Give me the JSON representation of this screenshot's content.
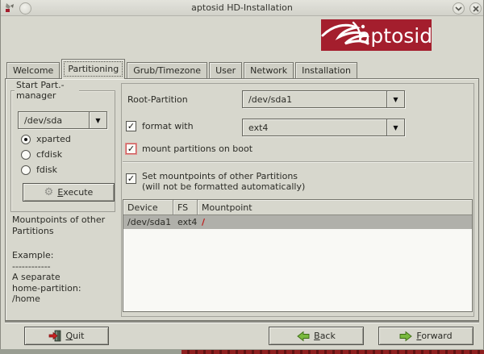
{
  "window": {
    "title": "aptosid HD-Installation"
  },
  "titlebar": {
    "shade_icon": "∨",
    "close_icon": "×"
  },
  "logo": {
    "brand": "aptosid"
  },
  "tabs": [
    {
      "label": "Welcome"
    },
    {
      "label": "Partitioning"
    },
    {
      "label": "Grub/Timezone"
    },
    {
      "label": "User"
    },
    {
      "label": "Network"
    },
    {
      "label": "Installation"
    }
  ],
  "left_panel": {
    "group_title": "Start Part.-manager",
    "disk_combo_value": "/dev/sda",
    "radio_options": [
      {
        "label": "xparted",
        "selected": true
      },
      {
        "label": "cfdisk",
        "selected": false
      },
      {
        "label": "fdisk",
        "selected": false
      }
    ],
    "execute_button": {
      "mnemonic": "E",
      "rest": "xecute"
    },
    "notes": {
      "heading": "Mountpoints of other Partitions",
      "example_label": "Example:",
      "divider": "------------",
      "line1": "A separate",
      "line2": "home-partition:",
      "line3": "/home"
    }
  },
  "main_panel": {
    "root_partition_label": "Root-Partition",
    "root_partition_value": "/dev/sda1",
    "format_checkbox_label": "format with",
    "format_combo_value": "ext4",
    "mount_boot_checkbox_label": "mount partitions on boot",
    "set_mountpoints_label_line1": "Set mountpoints of other Partitions",
    "set_mountpoints_label_line2": "(will not be formatted automatically)",
    "table": {
      "headers": [
        "Device",
        "FS",
        "Mountpoint"
      ],
      "rows": [
        {
          "device": "/dev/sda1",
          "fs": "ext4",
          "mountpoint": "/"
        }
      ]
    }
  },
  "footer": {
    "quit": {
      "mnemonic": "Q",
      "rest": "uit"
    },
    "back": {
      "mnemonic": "B",
      "rest": "ack"
    },
    "forward": {
      "mnemonic": "F",
      "rest": "orward"
    }
  },
  "icons": {
    "check": "✓",
    "dropdown_arrow": "▼",
    "gear": "⚙"
  },
  "colors": {
    "brand_red": "#a41e2d",
    "focus_red": "#cc5a5a",
    "mount_slash_red": "#c01818",
    "selected_row": "#b0b0aa"
  }
}
